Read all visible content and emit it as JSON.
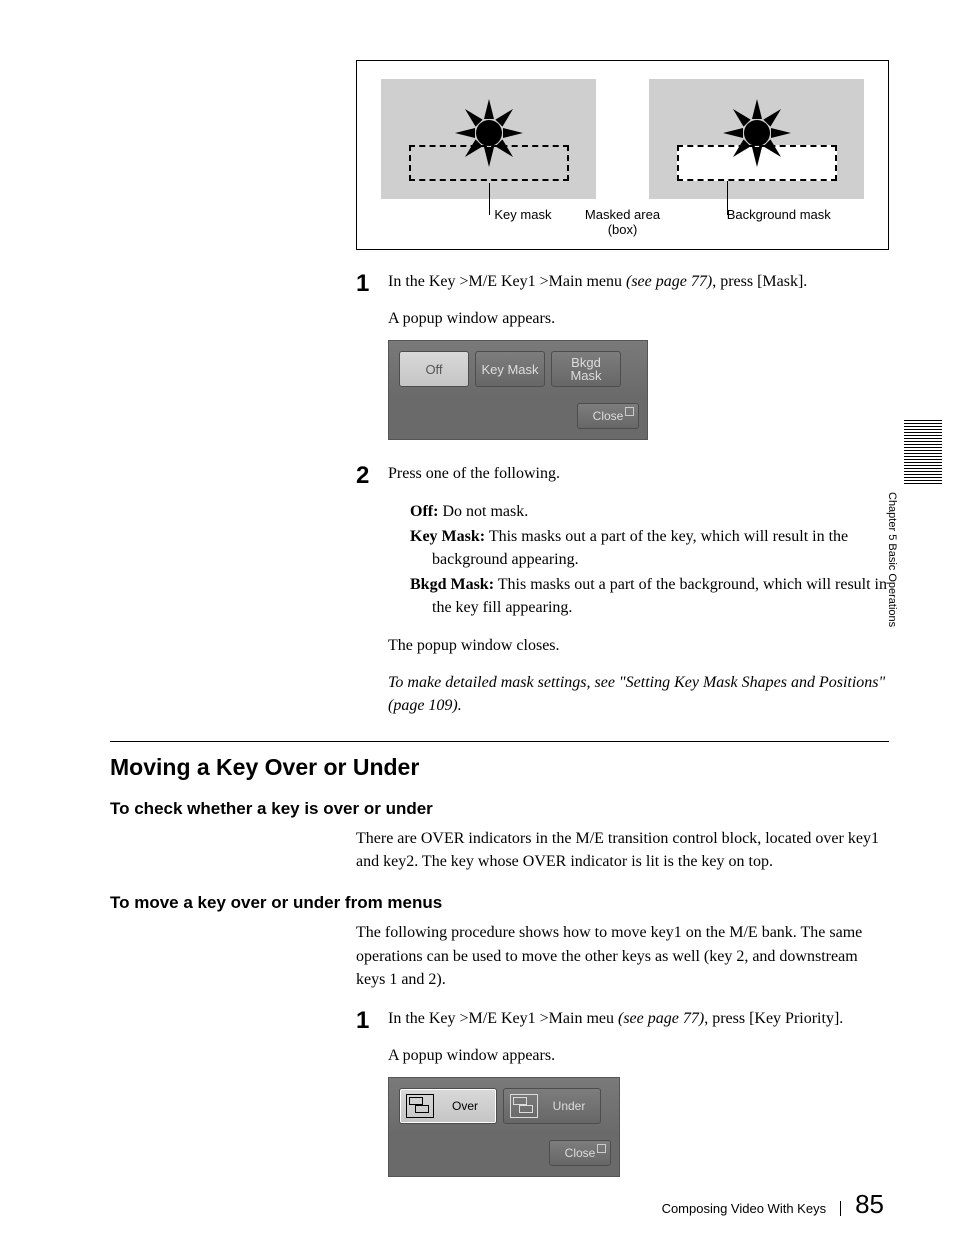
{
  "diagram": {
    "key_mask_label": "Key mask",
    "masked_area_label_line1": "Masked area",
    "masked_area_label_line2": "(box)",
    "background_mask_label": "Background mask"
  },
  "step1": {
    "num": "1",
    "text_a": "In the Key >M/E Key1 >Main menu ",
    "text_ref": "(see page 77)",
    "text_b": ", press [Mask].",
    "popup_intro": "A popup window appears."
  },
  "popup1": {
    "off": "Off",
    "key_mask": "Key Mask",
    "bkgd_mask_line1": "Bkgd",
    "bkgd_mask_line2": "Mask",
    "close": "Close"
  },
  "step2": {
    "num": "2",
    "text": "Press one of the following.",
    "defs": {
      "off": {
        "term": "Off:",
        "desc": " Do not mask."
      },
      "key": {
        "term": "Key Mask:",
        "desc": " This masks out a part of the key, which will result in the background appearing."
      },
      "bkgd": {
        "term": "Bkgd Mask:",
        "desc": " This masks out a part of the background, which will result in the key fill appearing."
      }
    },
    "closes": "The popup window closes.",
    "xref": "To make detailed mask settings, see \"Setting Key Mask Shapes and Positions\" (page 109)."
  },
  "section": {
    "h1": "Moving a Key Over or Under",
    "h2a": "To check whether a key is over or under",
    "para_a": "There are OVER indicators in the M/E transition control block, located over key1 and key2. The key whose OVER indicator is lit is the key on top.",
    "h2b": "To move a key over or under from menus",
    "para_b": "The following procedure shows how to move key1 on the M/E bank. The same operations can be used to move the other keys as well (key 2, and downstream keys 1 and 2)."
  },
  "step3": {
    "num": "1",
    "text_a": "In the Key >M/E Key1 >Main meu ",
    "text_ref": "(see page 77)",
    "text_b": ", press [Key Priority].",
    "popup_intro": "A popup window appears."
  },
  "popup2": {
    "over": "Over",
    "under": "Under",
    "close": "Close"
  },
  "side": {
    "label": "Chapter 5   Basic Operations"
  },
  "footer": {
    "section": "Composing Video With Keys",
    "page": "85"
  }
}
